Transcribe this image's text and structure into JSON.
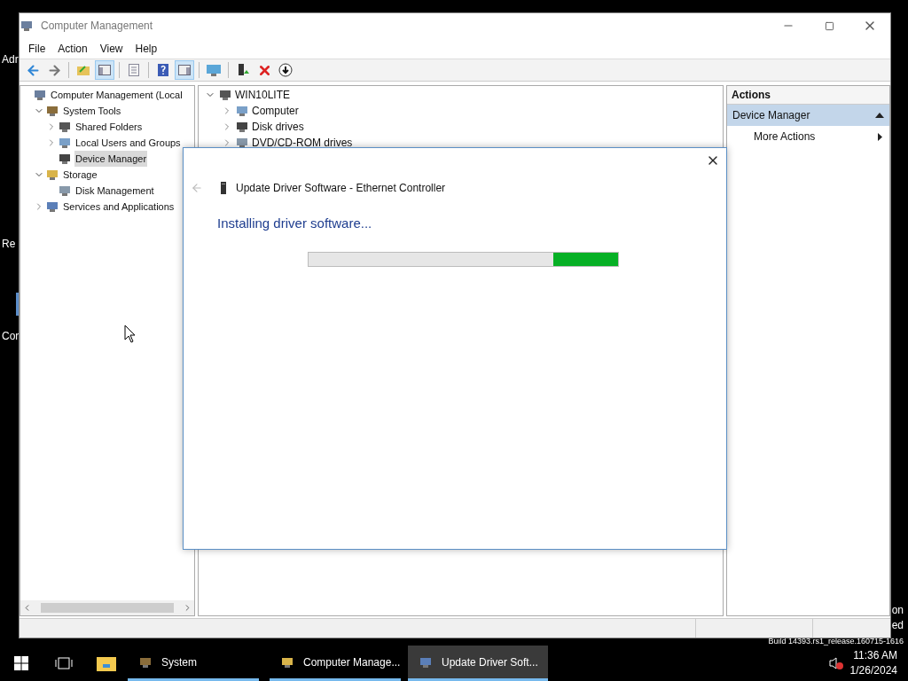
{
  "desktop": {
    "labels": [
      "Adr",
      "Re",
      "Cor"
    ],
    "right_labels": [
      "on",
      "ed"
    ],
    "build": "Build 14393.rs1_release.160715-1616"
  },
  "window": {
    "title": "Computer Management"
  },
  "menu": [
    "File",
    "Action",
    "View",
    "Help"
  ],
  "toolbar": [
    {
      "kind": "back",
      "pressed": false
    },
    {
      "kind": "forward",
      "pressed": false
    },
    {
      "kind": "sep"
    },
    {
      "kind": "up",
      "pressed": false
    },
    {
      "kind": "tree",
      "pressed": true
    },
    {
      "kind": "sep"
    },
    {
      "kind": "properties",
      "pressed": false
    },
    {
      "kind": "sep"
    },
    {
      "kind": "help",
      "pressed": false
    },
    {
      "kind": "actionpane",
      "pressed": true
    },
    {
      "kind": "sep"
    },
    {
      "kind": "monitor",
      "pressed": false
    },
    {
      "kind": "sep"
    },
    {
      "kind": "update",
      "pressed": false
    },
    {
      "kind": "delete",
      "pressed": false
    },
    {
      "kind": "download",
      "pressed": false
    }
  ],
  "tree": [
    {
      "label": "Computer Management (Local",
      "selected": false,
      "children": [
        {
          "label": "System Tools",
          "expanded": true,
          "selected": false,
          "children": [
            {
              "label": "Shared Folders",
              "expanded": false,
              "selected": false
            },
            {
              "label": "Local Users and Groups",
              "expanded": false,
              "selected": false
            },
            {
              "label": "Device Manager",
              "selected": true
            }
          ]
        },
        {
          "label": "Storage",
          "expanded": true,
          "selected": false,
          "children": [
            {
              "label": "Disk Management",
              "selected": false
            }
          ]
        },
        {
          "label": "Services and Applications",
          "expanded": false,
          "selected": false
        }
      ]
    }
  ],
  "devices": {
    "label": "WIN10LITE",
    "expanded": true,
    "children": [
      {
        "label": "Computer",
        "expanded": false
      },
      {
        "label": "Disk drives",
        "expanded": false
      },
      {
        "label": "DVD/CD-ROM drives",
        "expanded": false
      }
    ]
  },
  "actions": {
    "title": "Actions",
    "section": "Device Manager",
    "items": [
      "More Actions"
    ]
  },
  "dialog": {
    "title": "Update Driver Software - Ethernet Controller",
    "heading": "Installing driver software...",
    "progress": {
      "level": 0.21
    }
  },
  "taskbar": {
    "items": [
      {
        "label": "System",
        "selected": false
      },
      {
        "label": "Computer Manage...",
        "selected": false
      },
      {
        "label": "Update Driver Soft...",
        "selected": true
      }
    ],
    "time": "11:36 AM",
    "date": "1/26/2024"
  }
}
